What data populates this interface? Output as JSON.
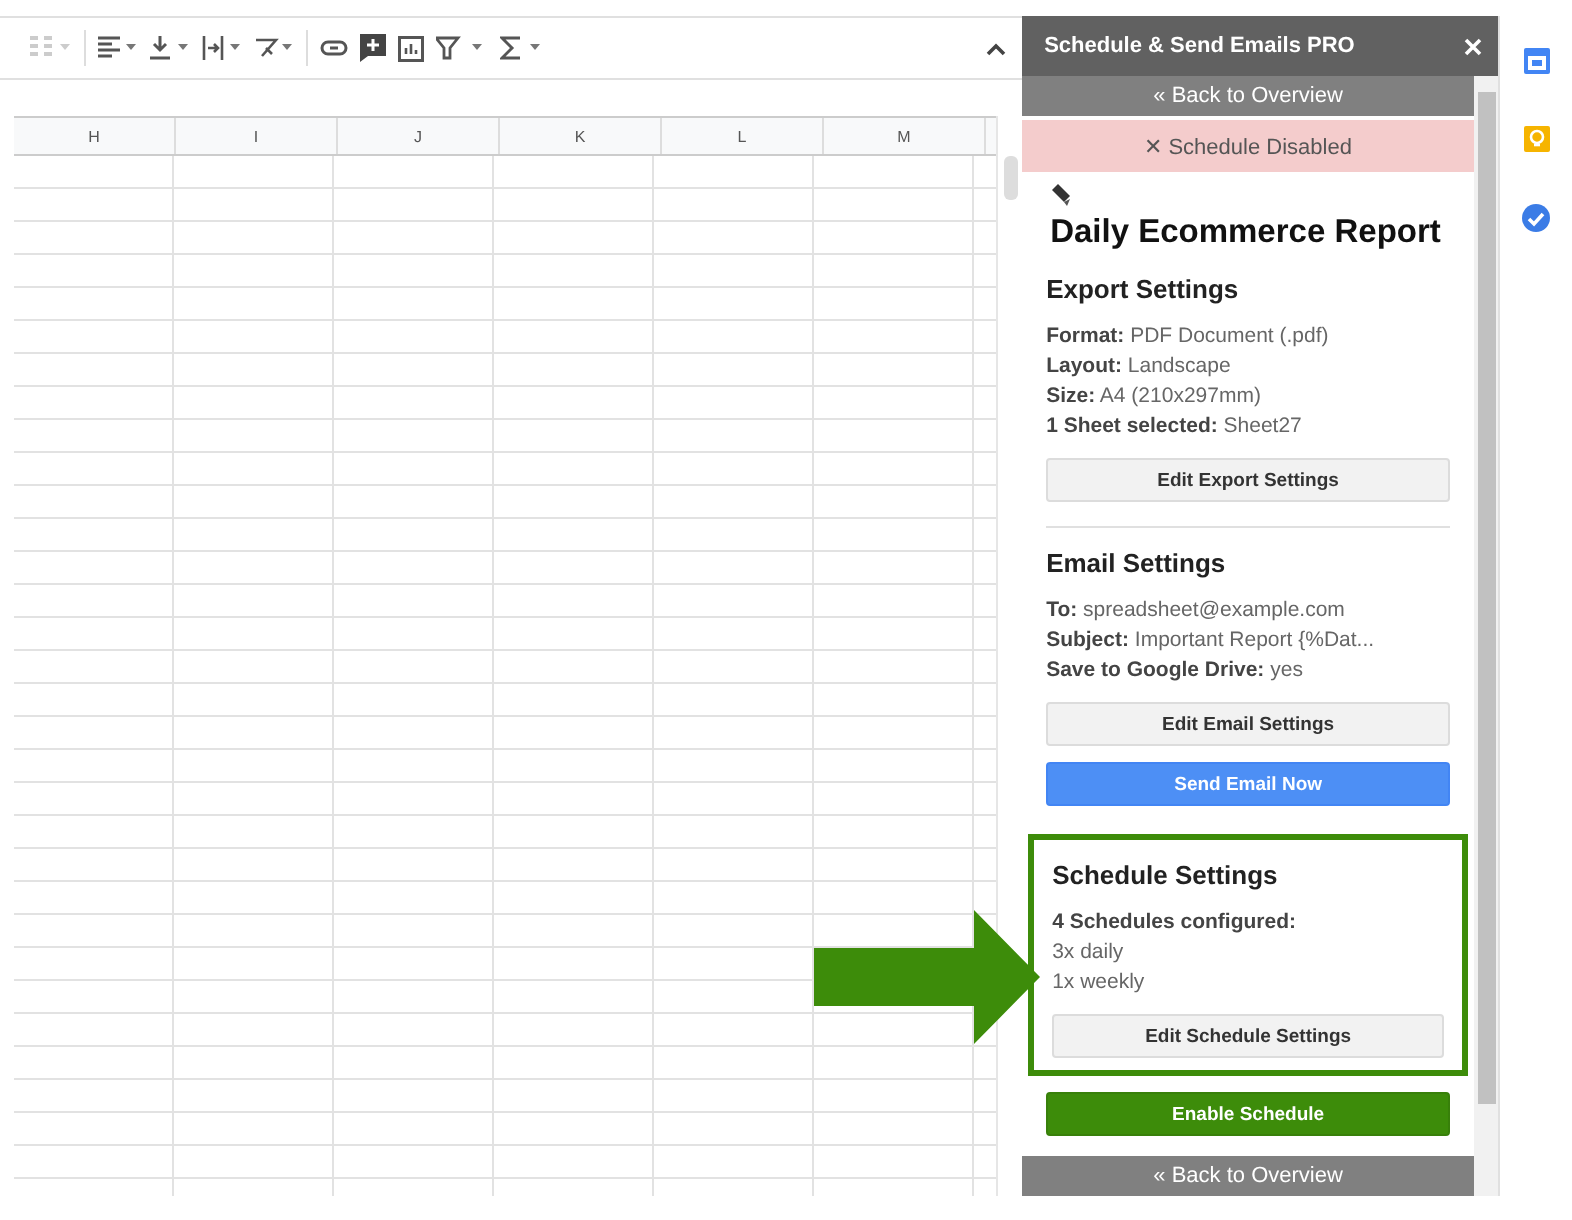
{
  "sheet": {
    "columns": [
      "H",
      "I",
      "J",
      "K",
      "L",
      "M"
    ]
  },
  "sidebar": {
    "title": "Schedule & Send Emails PRO",
    "back_link": "« Back to Overview",
    "status": {
      "text": "✕ Schedule Disabled",
      "enabled": false
    },
    "report_title": "Daily Ecommerce Report",
    "sections": [
      {
        "heading": "Export Settings",
        "highlighted": false,
        "lines": [
          "**Format:** PDF Document (.pdf)",
          "**Layout:** Landscape",
          "**Size:** A4 (210x297mm)",
          "**1 Sheet selected:** Sheet27"
        ],
        "buttons": [
          {
            "label": "Edit Export Settings",
            "kind": "default"
          }
        ]
      },
      {
        "heading": "Email Settings",
        "highlighted": false,
        "lines": [
          "**To:** spreadsheet@example.com",
          "**Subject:** Important Report {%Dat...",
          "**Save to Google Drive:** yes"
        ],
        "buttons": [
          {
            "label": "Edit Email Settings",
            "kind": "default"
          },
          {
            "label": "Send Email Now",
            "kind": "primary"
          }
        ]
      },
      {
        "heading": "Schedule Settings",
        "highlighted": true,
        "lines": [
          "**4 Schedules configured:**",
          "3x daily",
          "1x weekly"
        ],
        "buttons": [
          {
            "label": "Edit Schedule Settings",
            "kind": "default"
          }
        ]
      }
    ],
    "enable_button": "Enable Schedule",
    "footer_link": "« Back to Overview"
  }
}
